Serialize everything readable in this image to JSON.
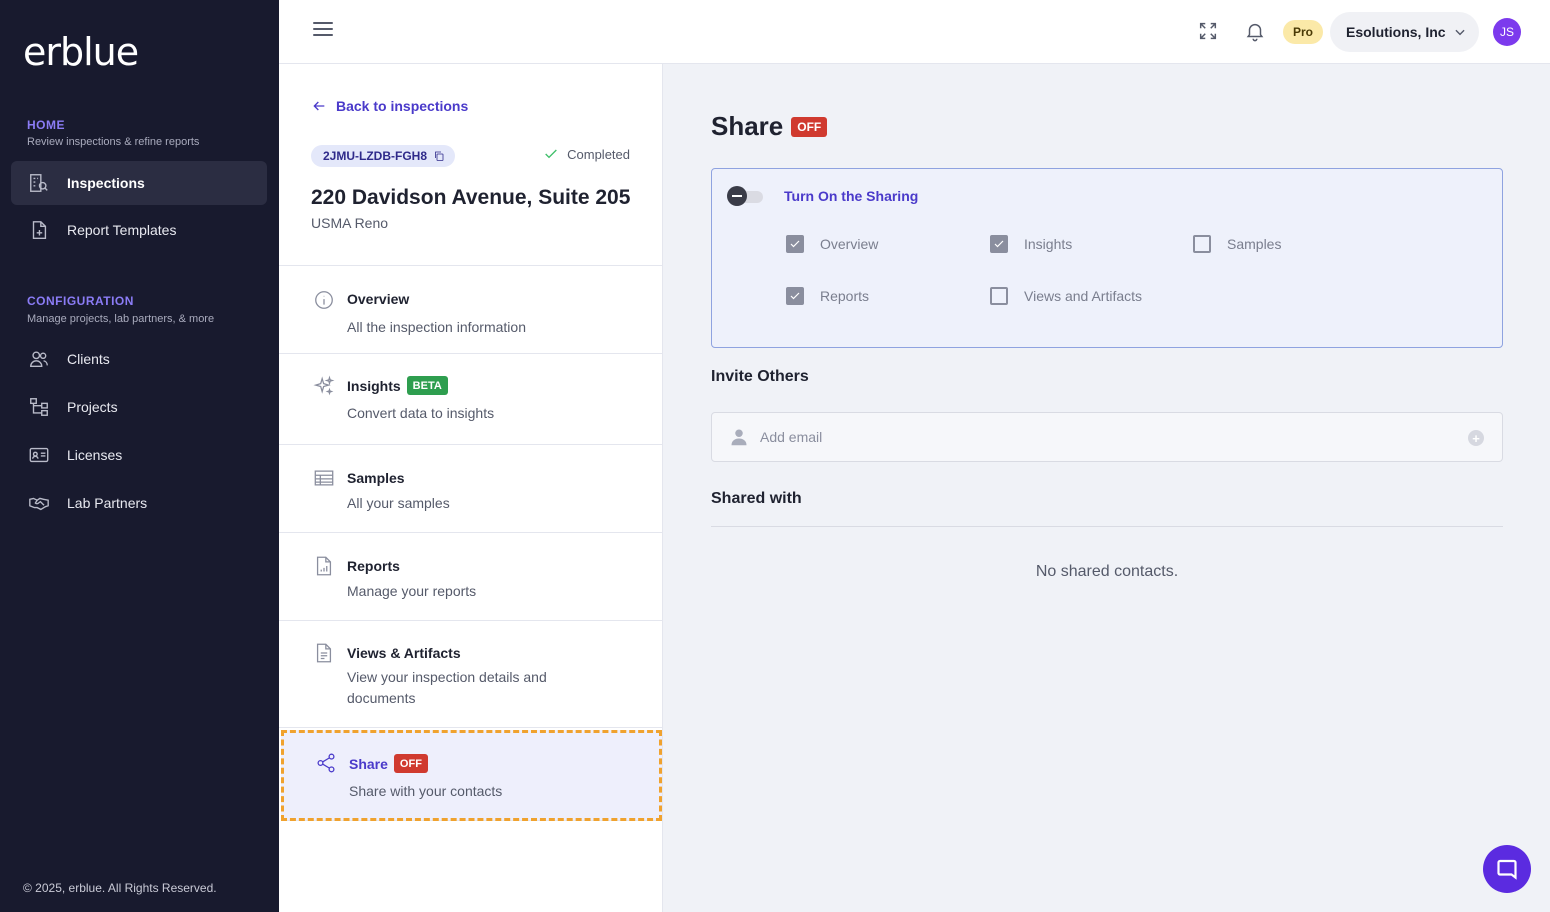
{
  "brand": {
    "logo": "erblue",
    "footer": "© 2025, erblue. All Rights Reserved."
  },
  "sidebar": {
    "sections": [
      {
        "title": "HOME",
        "subtitle": "Review inspections & refine reports"
      },
      {
        "title": "CONFIGURATION",
        "subtitle": "Manage projects, lab partners, & more"
      }
    ],
    "items": [
      {
        "label": "Inspections",
        "icon": "building-search-icon",
        "active": true
      },
      {
        "label": "Report Templates",
        "icon": "document-plus-icon",
        "active": false
      },
      {
        "label": "Clients",
        "icon": "users-icon",
        "active": false
      },
      {
        "label": "Projects",
        "icon": "hierarchy-icon",
        "active": false
      },
      {
        "label": "Licenses",
        "icon": "id-card-icon",
        "active": false
      },
      {
        "label": "Lab Partners",
        "icon": "handshake-icon",
        "active": false
      }
    ]
  },
  "topbar": {
    "plan_badge": "Pro",
    "org_name": "Esolutions, Inc",
    "avatar_initials": "JS",
    "colors": {
      "avatar": "#7c3aed",
      "pro": "#fbe9a8"
    }
  },
  "inspection": {
    "back_label": "Back to inspections",
    "code": "2JMU-LZDB-FGH8",
    "status": "Completed",
    "address": "220 Davidson Avenue, Suite 205",
    "organization": "USMA Reno",
    "menu": [
      {
        "title": "Overview",
        "subtitle": "All the inspection information",
        "icon": "info-icon"
      },
      {
        "title": "Insights",
        "badge": "BETA",
        "subtitle": "Convert data to insights",
        "icon": "sparkles-icon"
      },
      {
        "title": "Samples",
        "subtitle": "All your samples",
        "icon": "table-icon"
      },
      {
        "title": "Reports",
        "subtitle": "Manage your reports",
        "icon": "report-chart-icon"
      },
      {
        "title": "Views & Artifacts",
        "subtitle": "View your inspection details and documents",
        "icon": "document-icon"
      },
      {
        "title": "Share",
        "badge": "OFF",
        "subtitle": "Share with your contacts",
        "icon": "share-icon",
        "active": true
      }
    ]
  },
  "share": {
    "title": "Share",
    "status_badge": "OFF",
    "toggle_label": "Turn On the Sharing",
    "toggle_on": false,
    "options": [
      {
        "label": "Overview",
        "checked": true
      },
      {
        "label": "Insights",
        "checked": true
      },
      {
        "label": "Samples",
        "checked": false
      },
      {
        "label": "Reports",
        "checked": true
      },
      {
        "label": "Views and Artifacts",
        "checked": false
      }
    ],
    "invite_title": "Invite Others",
    "email_placeholder": "Add email",
    "shared_title": "Shared with",
    "empty_message": "No shared contacts."
  }
}
